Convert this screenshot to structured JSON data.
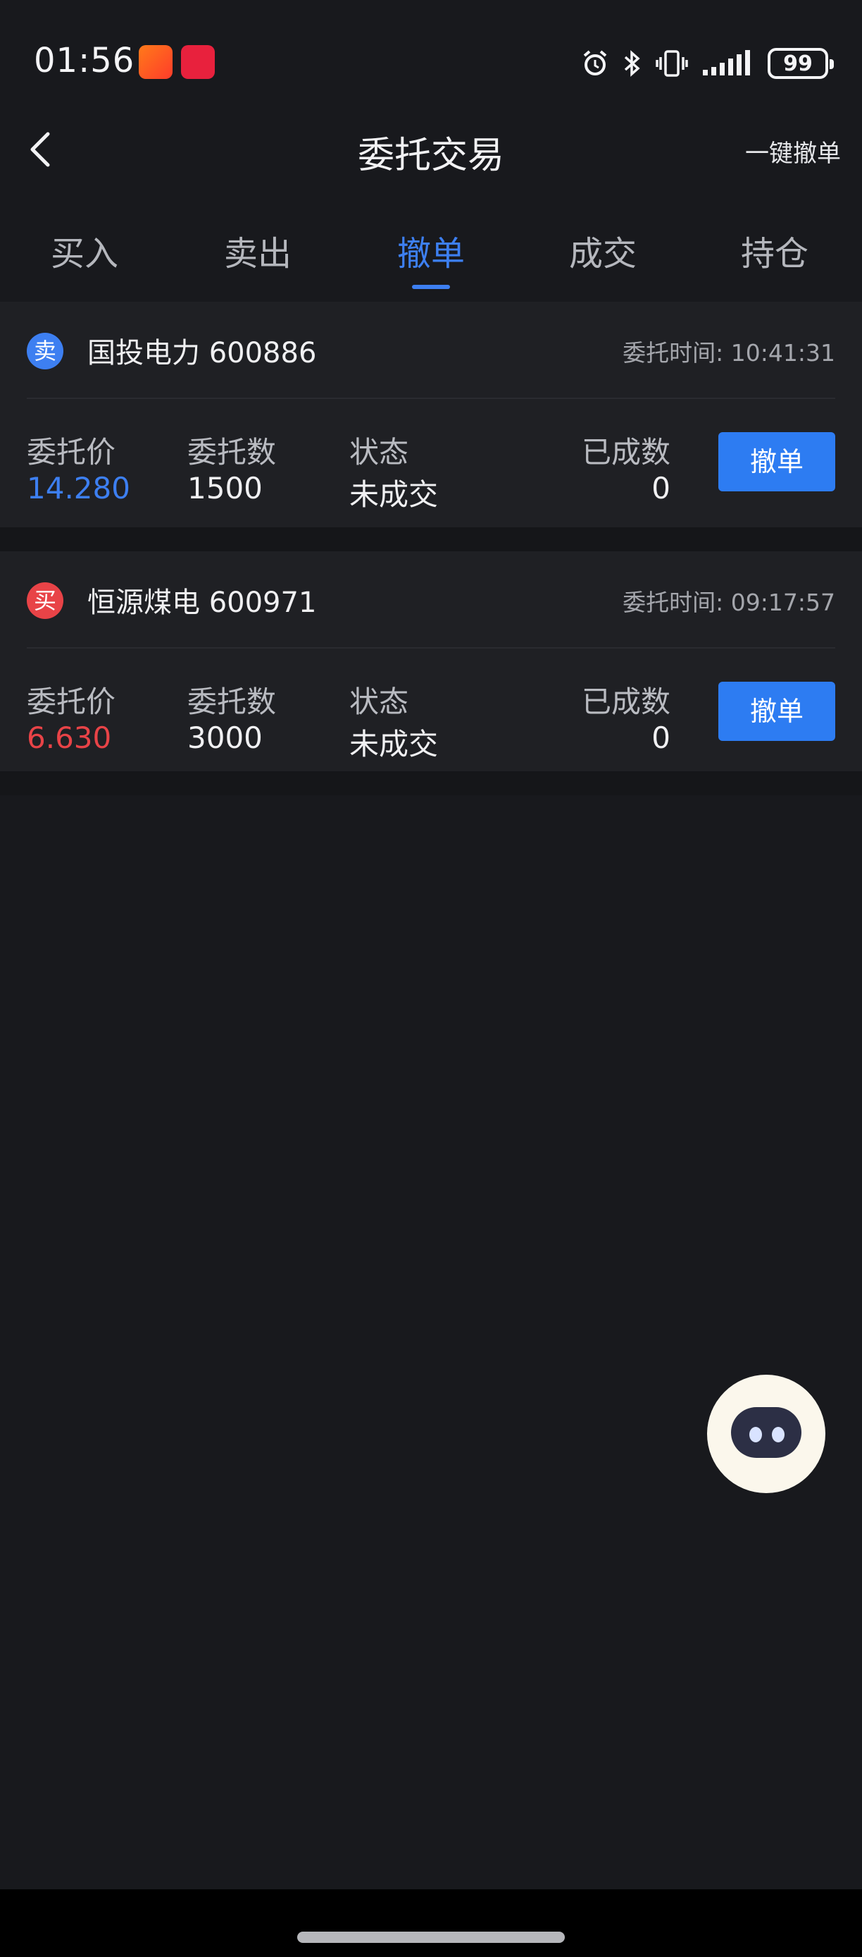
{
  "status_bar": {
    "time": "01:56",
    "apps": [
      "taobao-icon",
      "app-gallery-icon"
    ],
    "battery": "99"
  },
  "header": {
    "title": "委托交易",
    "cancel_all": "一键撤单"
  },
  "tabs": [
    {
      "label": "买入",
      "active": false
    },
    {
      "label": "卖出",
      "active": false
    },
    {
      "label": "撤单",
      "active": true
    },
    {
      "label": "成交",
      "active": false
    },
    {
      "label": "持仓",
      "active": false
    }
  ],
  "columns": {
    "price": "委托价",
    "quantity": "委托数",
    "status": "状态",
    "filled": "已成数"
  },
  "orders": [
    {
      "side": "卖",
      "stock": "国投电力 600886",
      "time": "委托时间: 10:41:31",
      "price": "14.280",
      "quantity": "1500",
      "status": "未成交",
      "filled": "0",
      "cancel_label": "撤单"
    },
    {
      "side": "买",
      "stock": "恒源煤电 600971",
      "time": "委托时间: 09:17:57",
      "price": "6.630",
      "quantity": "3000",
      "status": "未成交",
      "filled": "0",
      "cancel_label": "撤单"
    }
  ],
  "colors": {
    "accent": "#3d7ff1",
    "sell": "#3d7ff1",
    "buy": "#e84347",
    "background": "#18191d",
    "card": "#1f2024"
  }
}
